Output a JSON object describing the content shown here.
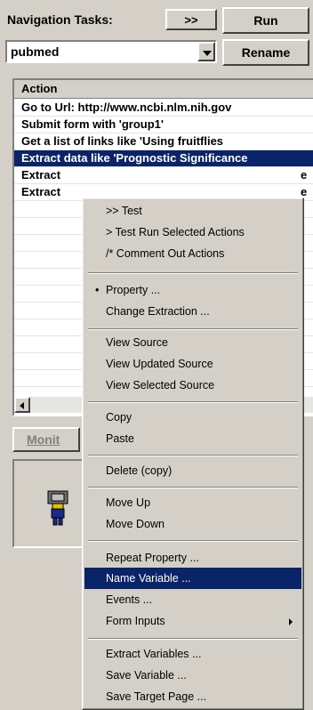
{
  "toolbar": {
    "nav_tasks_label": "Navigation Tasks:",
    "expand_label": ">>",
    "run_label": "Run",
    "rename_label": "Rename",
    "task_select_value": "pubmed"
  },
  "actions": {
    "header": "Action",
    "rows": [
      "Go to Url: http://www.ncbi.nlm.nih.gov",
      "Submit form with 'group1'",
      "Get a list of links like 'Using fruitflies",
      "Extract data like 'Prognostic Significance",
      "Extract",
      "Extract"
    ],
    "row4_suffix": "e",
    "row5_suffix": "e"
  },
  "monitor_button": "Monit",
  "context_menu": {
    "items": [
      {
        "label": ">> Test"
      },
      {
        "label": "> Test Run Selected Actions"
      },
      {
        "label": "/* Comment Out Actions"
      },
      {
        "label": "Property ..."
      },
      {
        "label": "Change Extraction ..."
      },
      {
        "label": "View Source"
      },
      {
        "label": "View Updated Source"
      },
      {
        "label": "View Selected Source"
      },
      {
        "label": "Copy"
      },
      {
        "label": "Paste"
      },
      {
        "label": "Delete (copy)"
      },
      {
        "label": "Move Up"
      },
      {
        "label": "Move Down"
      },
      {
        "label": "Repeat Property ..."
      },
      {
        "label": "Name Variable ..."
      },
      {
        "label": "Events ..."
      },
      {
        "label": "Form Inputs"
      },
      {
        "label": "Extract Variables ..."
      },
      {
        "label": "Save Variable ..."
      },
      {
        "label": "Save Target Page ..."
      }
    ],
    "highlighted": "Name Variable ...",
    "checked": "Property ..."
  },
  "colors": {
    "selection": "#0a246a",
    "face": "#d4d0c8"
  }
}
